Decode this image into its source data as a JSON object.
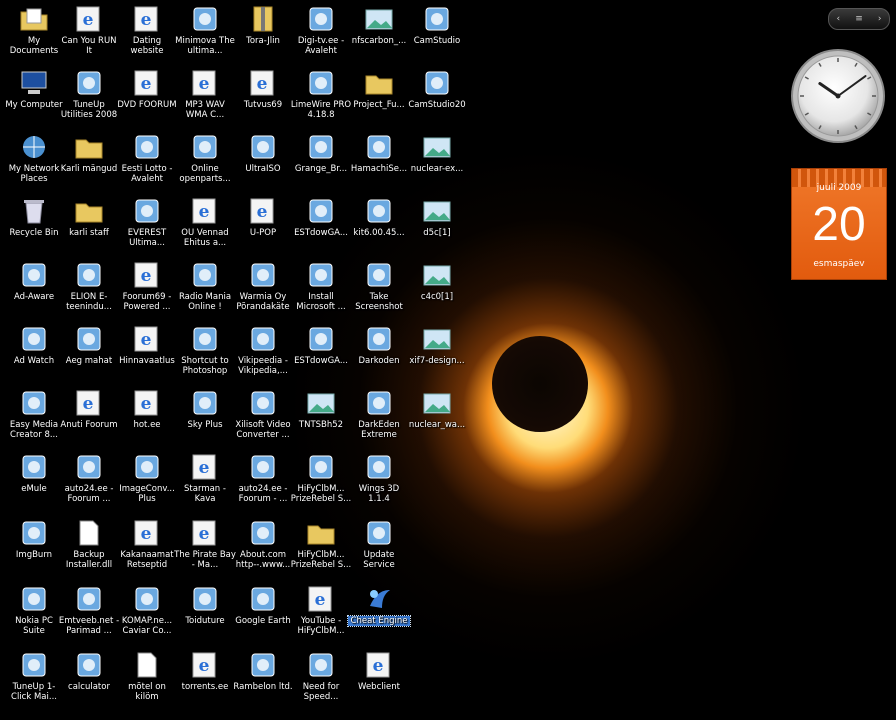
{
  "desktop": {
    "icons": [
      {
        "label": "My Documents",
        "icon": "documents-folder-icon",
        "col": 0,
        "row": 0
      },
      {
        "label": "My Computer",
        "icon": "computer-icon",
        "col": 0,
        "row": 1
      },
      {
        "label": "My Network Places",
        "icon": "network-places-icon",
        "col": 0,
        "row": 2
      },
      {
        "label": "Recycle Bin",
        "icon": "recycle-bin-icon",
        "col": 0,
        "row": 3
      },
      {
        "label": "Ad-Aware",
        "icon": "ad-aware-icon",
        "col": 0,
        "row": 4
      },
      {
        "label": "Ad Watch",
        "icon": "ad-watch-icon",
        "col": 0,
        "row": 5
      },
      {
        "label": "Easy Media Creator 8...",
        "icon": "media-creator-icon",
        "col": 0,
        "row": 6
      },
      {
        "label": "eMule",
        "icon": "emule-icon",
        "col": 0,
        "row": 7
      },
      {
        "label": "ImgBurn",
        "icon": "imgburn-icon",
        "col": 0,
        "row": 8
      },
      {
        "label": "Nokia PC Suite",
        "icon": "nokia-icon",
        "col": 0,
        "row": 9
      },
      {
        "label": "TuneUp 1-Click Mai...",
        "icon": "tuneup-icon",
        "col": 0,
        "row": 10
      },
      {
        "label": "Can You RUN It",
        "icon": "ie-shortcut-icon",
        "col": 1,
        "row": 0
      },
      {
        "label": "TuneUp Utilities 2008",
        "icon": "tuneup-icon",
        "col": 1,
        "row": 1
      },
      {
        "label": "Karli mängud",
        "icon": "folder-icon",
        "col": 1,
        "row": 2
      },
      {
        "label": "karli staff",
        "icon": "folder-icon",
        "col": 1,
        "row": 3
      },
      {
        "label": "ELION E-teenindu...",
        "icon": "elion-icon",
        "col": 1,
        "row": 4
      },
      {
        "label": "Aeg mahat",
        "icon": "text-icon",
        "col": 1,
        "row": 5
      },
      {
        "label": "Anuti Foorum",
        "icon": "ie-shortcut-icon",
        "col": 1,
        "row": 6
      },
      {
        "label": "auto24.ee - Foorum ...",
        "icon": "auto24-icon",
        "col": 1,
        "row": 7
      },
      {
        "label": "Backup Installer.dll",
        "icon": "document-icon",
        "col": 1,
        "row": 8
      },
      {
        "label": "Emtveeb.net - Parimad ...",
        "icon": "emt-icon",
        "col": 1,
        "row": 9
      },
      {
        "label": "calculator",
        "icon": "calculator-icon",
        "col": 1,
        "row": 10
      },
      {
        "label": "Dating website",
        "icon": "ie-shortcut-icon",
        "col": 2,
        "row": 0
      },
      {
        "label": "DVD FOORUM",
        "icon": "ie-shortcut-icon",
        "col": 2,
        "row": 1
      },
      {
        "label": "Eesti Lotto - Avaleht",
        "icon": "lotto-icon",
        "col": 2,
        "row": 2
      },
      {
        "label": "EVEREST Ultima...",
        "icon": "everest-icon",
        "col": 2,
        "row": 3
      },
      {
        "label": "Foorum69 - Powered ...",
        "icon": "ie-shortcut-icon",
        "col": 2,
        "row": 4
      },
      {
        "label": "Hinnavaatlus",
        "icon": "ie-shortcut-icon",
        "col": 2,
        "row": 5
      },
      {
        "label": "hot.ee",
        "icon": "ie-shortcut-icon",
        "col": 2,
        "row": 6
      },
      {
        "label": "ImageConv... Plus",
        "icon": "image-converter-icon",
        "col": 2,
        "row": 7
      },
      {
        "label": "Kakanaamat Retseptid",
        "icon": "ie-shortcut-icon",
        "col": 2,
        "row": 8
      },
      {
        "label": "KOMAP.ne... Caviar Co...",
        "icon": "komap-icon",
        "col": 2,
        "row": 9
      },
      {
        "label": "mõtel on kilöm",
        "icon": "document-icon",
        "col": 2,
        "row": 10
      },
      {
        "label": "Minimova The ultima...",
        "icon": "app-icon",
        "col": 3,
        "row": 0
      },
      {
        "label": "MP3 WAV WMA C...",
        "icon": "ie-shortcut-icon",
        "col": 3,
        "row": 1
      },
      {
        "label": "Online openparts...",
        "icon": "online-icon",
        "col": 3,
        "row": 2
      },
      {
        "label": "OÜ Vennad Ehitus a...",
        "icon": "ie-shortcut-icon",
        "col": 3,
        "row": 3
      },
      {
        "label": "Radio Mania Online !",
        "icon": "radio-icon",
        "col": 3,
        "row": 4
      },
      {
        "label": "Shortcut to Photoshop",
        "icon": "photoshop-icon",
        "col": 3,
        "row": 5
      },
      {
        "label": "Sky Plus",
        "icon": "sky-icon",
        "col": 3,
        "row": 6
      },
      {
        "label": "Starman - Kava",
        "icon": "ie-shortcut-icon",
        "col": 3,
        "row": 7
      },
      {
        "label": "The Pirate Bay - Ma...",
        "icon": "ie-shortcut-icon",
        "col": 3,
        "row": 8
      },
      {
        "label": "Toiduture",
        "icon": "toiduture-icon",
        "col": 3,
        "row": 9
      },
      {
        "label": "torrents.ee",
        "icon": "ie-shortcut-icon",
        "col": 3,
        "row": 10
      },
      {
        "label": "Tora-Jlin",
        "icon": "zip-icon",
        "col": 4,
        "row": 0
      },
      {
        "label": "Tutvus69",
        "icon": "ie-shortcut-icon",
        "col": 4,
        "row": 1
      },
      {
        "label": "UltraISO",
        "icon": "ultraiso-icon",
        "col": 4,
        "row": 2
      },
      {
        "label": "U-POP",
        "icon": "ie-shortcut-icon",
        "col": 4,
        "row": 3
      },
      {
        "label": "Warmia Oy Põrandakäte",
        "icon": "warmia-icon",
        "col": 4,
        "row": 4
      },
      {
        "label": "Vikipeedia - Vikipedia,...",
        "icon": "wikipedia-icon",
        "col": 4,
        "row": 5
      },
      {
        "label": "Xilisoft Video Converter ...",
        "icon": "xilisoft-icon",
        "col": 4,
        "row": 6
      },
      {
        "label": "auto24.ee - Foorum - ...",
        "icon": "auto24-icon",
        "col": 4,
        "row": 7
      },
      {
        "label": "About.com http--.www...",
        "icon": "about-icon",
        "col": 4,
        "row": 8
      },
      {
        "label": "Google Earth",
        "icon": "google-earth-icon",
        "col": 4,
        "row": 9
      },
      {
        "label": "Rambelon ltd.",
        "icon": "rambelon-icon",
        "col": 4,
        "row": 10
      },
      {
        "label": "Digi-tv.ee - Avaleht",
        "icon": "digitv-icon",
        "col": 5,
        "row": 0
      },
      {
        "label": "LimeWire PRO 4.18.8",
        "icon": "limewire-icon",
        "col": 5,
        "row": 1
      },
      {
        "label": "Grange_Br...",
        "icon": "grange-icon",
        "col": 5,
        "row": 2
      },
      {
        "label": "ESTdowGA...",
        "icon": "estdow-icon",
        "col": 5,
        "row": 3
      },
      {
        "label": "Install Microsoft ...",
        "icon": "install-icon",
        "col": 5,
        "row": 4
      },
      {
        "label": "ESTdowGA...",
        "icon": "estdow-icon",
        "col": 5,
        "row": 5
      },
      {
        "label": "TNTSBh52",
        "icon": "image-file-icon",
        "col": 5,
        "row": 6
      },
      {
        "label": "HiFyClbM... PrizeRebel S...",
        "icon": "hify-icon",
        "col": 5,
        "row": 7
      },
      {
        "label": "HiFyClbM... PrizeRebel S...",
        "icon": "folder-icon",
        "col": 5,
        "row": 8
      },
      {
        "label": "YouTube - HiFyClbM...",
        "icon": "ie-shortcut-icon",
        "col": 5,
        "row": 9
      },
      {
        "label": "Need for Speed...",
        "icon": "nfs-icon",
        "col": 5,
        "row": 10
      },
      {
        "label": "nfscarbon_...",
        "icon": "image-file-icon",
        "col": 6,
        "row": 0
      },
      {
        "label": "Project_Fu...",
        "icon": "folder-icon",
        "col": 6,
        "row": 1
      },
      {
        "label": "HamachiSe...",
        "icon": "hamachi-icon",
        "col": 6,
        "row": 2
      },
      {
        "label": "kit6.00.45...",
        "icon": "kit-icon",
        "col": 6,
        "row": 3
      },
      {
        "label": "Take Screenshot",
        "icon": "screenshot-icon",
        "col": 6,
        "row": 4
      },
      {
        "label": "Darkoden",
        "icon": "darkoden-icon",
        "col": 6,
        "row": 5
      },
      {
        "label": "DarkEden Extreme",
        "icon": "darkeden-icon",
        "col": 6,
        "row": 6
      },
      {
        "label": "Wings 3D 1.1.4",
        "icon": "wings3d-icon",
        "col": 6,
        "row": 7
      },
      {
        "label": "Update Service",
        "icon": "update-icon",
        "col": 6,
        "row": 8
      },
      {
        "label": "Cheat Engine",
        "icon": "cheat-engine-icon",
        "col": 6,
        "row": 9,
        "selected": true
      },
      {
        "label": "Webclient",
        "icon": "ie-shortcut-icon",
        "col": 6,
        "row": 10
      },
      {
        "label": "CamStudio",
        "icon": "camstudio-icon",
        "col": 7,
        "row": 0
      },
      {
        "label": "CamStudio20",
        "icon": "camstudio-icon",
        "col": 7,
        "row": 1
      },
      {
        "label": "nuclear-ex...",
        "icon": "image-file-icon",
        "col": 7,
        "row": 2
      },
      {
        "label": "d5c[1]",
        "icon": "image-file-icon",
        "col": 7,
        "row": 3
      },
      {
        "label": "c4c0[1]",
        "icon": "image-file-icon",
        "col": 7,
        "row": 4
      },
      {
        "label": "xif7-design...",
        "icon": "image-file-icon",
        "col": 7,
        "row": 5
      },
      {
        "label": "nuclear_wa...",
        "icon": "image-file-icon",
        "col": 7,
        "row": 6
      }
    ]
  },
  "gadgets": {
    "nav": {
      "prev": "‹",
      "menu": "≡",
      "next": "›"
    },
    "clock": {
      "hour": 10,
      "minute": 9
    },
    "calendar": {
      "month_year": "juuli 2009",
      "day": "20",
      "weekday": "esmaspäev"
    }
  },
  "colors": {
    "ie": "#2a6fd6",
    "folder": "#e8c860",
    "selection": "#3a7bd5",
    "calendar": "#e8661a"
  }
}
